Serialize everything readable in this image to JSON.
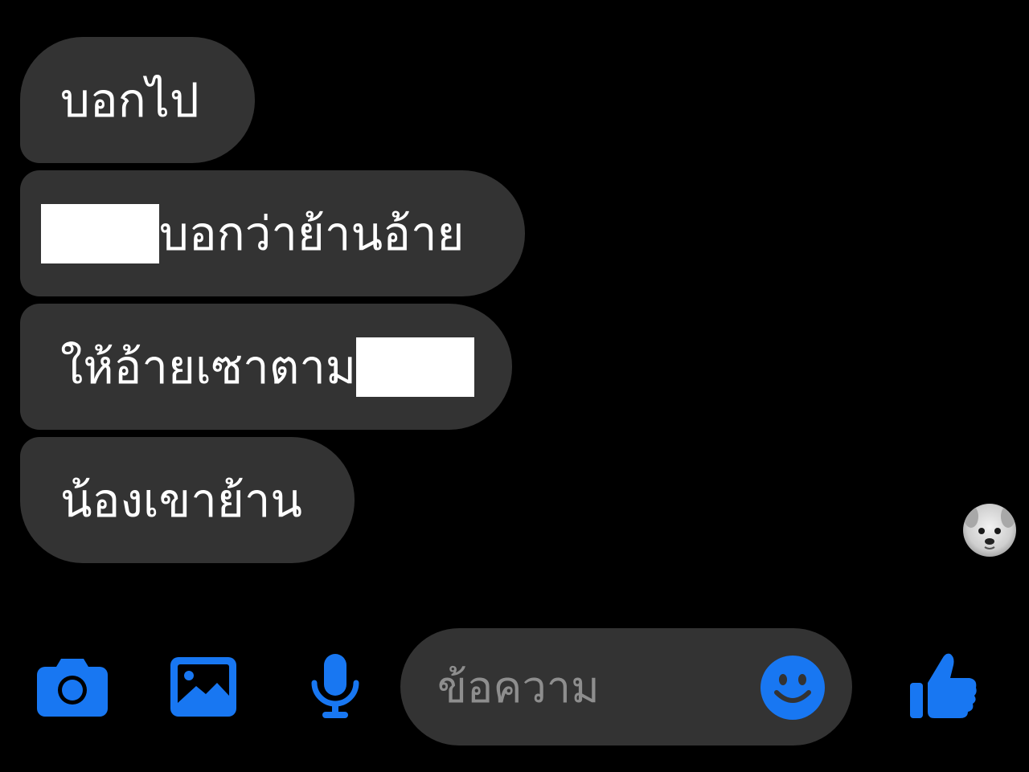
{
  "messages": [
    {
      "text_before": "บอกไป",
      "text_after": ""
    },
    {
      "text_before": "",
      "text_after": "บอกว่าย้านอ้าย"
    },
    {
      "text_before": "ให้อ้ายเซาตาม",
      "text_after": ""
    },
    {
      "text_before": "น้องเขาย้าน",
      "text_after": ""
    }
  ],
  "composer": {
    "placeholder": "ข้อความ"
  },
  "icons": {
    "camera": "camera-icon",
    "gallery": "image-icon",
    "microphone": "microphone-icon",
    "emoji": "smiley-icon",
    "like": "thumbs-up-icon"
  },
  "colors": {
    "background": "#000000",
    "bubble": "#333333",
    "accent": "#1877f2",
    "text": "#ffffff",
    "placeholder": "#8e8e8e"
  }
}
